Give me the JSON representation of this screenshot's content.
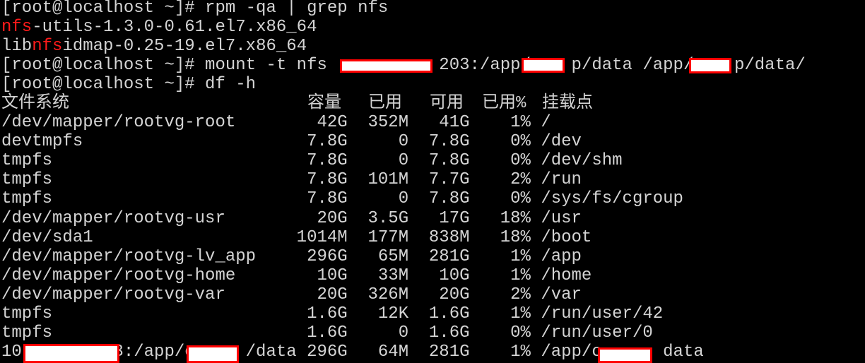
{
  "terminal": {
    "commands": {
      "rpm": "[root@localhost ~]# rpm -qa | grep nfs",
      "pkg1": {
        "hl": "nfs",
        "rest": "-utils-1.3.0-0.61.el7.x86_64"
      },
      "pkg2": {
        "pre": "lib",
        "hl": "nfs",
        "rest": "idmap-0.25-19.el7.x86_64"
      },
      "mount": "[root@localhost ~]# mount -t nfs           203:/app/    p/data /app/c   p/data/",
      "df": "[root@localhost ~]# df -h"
    },
    "df_header": [
      "文件系统",
      "容量",
      "已用",
      "可用",
      "已用%",
      "挂载点"
    ],
    "df_rows": [
      [
        "/dev/mapper/rootvg-root",
        "42G",
        "352M",
        "41G",
        "1%",
        "/"
      ],
      [
        "devtmpfs",
        "7.8G",
        "0",
        "7.8G",
        "0%",
        "/dev"
      ],
      [
        "tmpfs",
        "7.8G",
        "0",
        "7.8G",
        "0%",
        "/dev/shm"
      ],
      [
        "tmpfs",
        "7.8G",
        "101M",
        "7.7G",
        "2%",
        "/run"
      ],
      [
        "tmpfs",
        "7.8G",
        "0",
        "7.8G",
        "0%",
        "/sys/fs/cgroup"
      ],
      [
        "/dev/mapper/rootvg-usr",
        "20G",
        "3.5G",
        "17G",
        "18%",
        "/usr"
      ],
      [
        "/dev/sda1",
        "1014M",
        "177M",
        "838M",
        "18%",
        "/boot"
      ],
      [
        "/dev/mapper/rootvg-lv_app",
        "296G",
        "65M",
        "281G",
        "1%",
        "/app"
      ],
      [
        "/dev/mapper/rootvg-home",
        "10G",
        "33M",
        "10G",
        "1%",
        "/home"
      ],
      [
        "/dev/mapper/rootvg-var",
        "20G",
        "326M",
        "20G",
        "2%",
        "/var"
      ],
      [
        "tmpfs",
        "1.6G",
        "12K",
        "1.6G",
        "1%",
        "/run/user/42"
      ],
      [
        "tmpfs",
        "1.6G",
        "0",
        "1.6G",
        "0%",
        "/run/user/0"
      ],
      [
        "10         3:/app/c     /data",
        "296G",
        "64M",
        "281G",
        "1%",
        "/app/c      data"
      ]
    ],
    "colors": {
      "text": "#d4d4d4",
      "highlight": "#ff1a1a",
      "background": "#000000",
      "redaction_border": "#ff0000"
    }
  }
}
